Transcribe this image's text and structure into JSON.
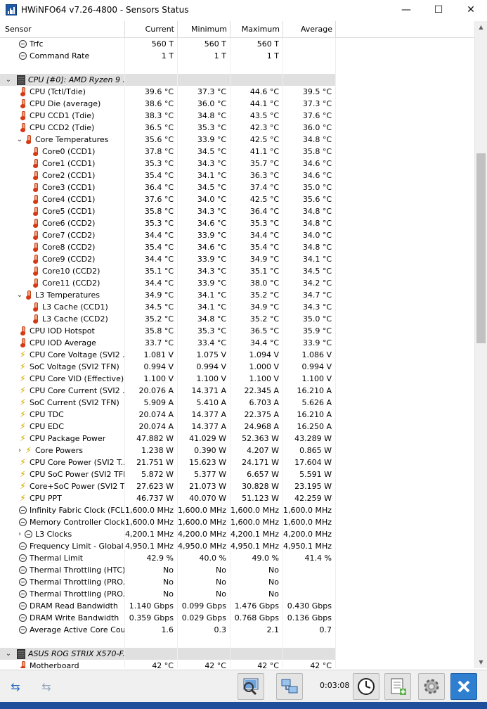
{
  "window": {
    "title": "HWiNFO64 v7.26-4800 - Sensors Status",
    "minimize": "—",
    "maximize": "☐",
    "close": "✕"
  },
  "columns": {
    "sensor": "Sensor",
    "current": "Current",
    "minimum": "Minimum",
    "maximum": "Maximum",
    "average": "Average"
  },
  "rows": [
    {
      "type": "item",
      "depth": 1,
      "icon": "minus",
      "name": "Trfc",
      "cur": "560 T",
      "min": "560 T",
      "max": "560 T",
      "avg": ""
    },
    {
      "type": "item",
      "depth": 1,
      "icon": "minus",
      "name": "Command Rate",
      "cur": "1 T",
      "min": "1 T",
      "max": "1 T",
      "avg": ""
    },
    {
      "type": "blank"
    },
    {
      "type": "group",
      "name": "CPU [#0]: AMD Ryzen 9 ...",
      "expander": "v"
    },
    {
      "type": "item",
      "depth": 1,
      "icon": "therm",
      "name": "CPU (Tctl/Tdie)",
      "cur": "39.6 °C",
      "min": "37.3 °C",
      "max": "44.6 °C",
      "avg": "39.5 °C"
    },
    {
      "type": "item",
      "depth": 1,
      "icon": "therm",
      "name": "CPU Die (average)",
      "cur": "38.6 °C",
      "min": "36.0 °C",
      "max": "44.1 °C",
      "avg": "37.3 °C"
    },
    {
      "type": "item",
      "depth": 1,
      "icon": "therm",
      "name": "CPU CCD1 (Tdie)",
      "cur": "38.3 °C",
      "min": "34.8 °C",
      "max": "43.5 °C",
      "avg": "37.6 °C"
    },
    {
      "type": "item",
      "depth": 1,
      "icon": "therm",
      "name": "CPU CCD2 (Tdie)",
      "cur": "36.5 °C",
      "min": "35.3 °C",
      "max": "42.3 °C",
      "avg": "36.0 °C"
    },
    {
      "type": "item",
      "depth": 1,
      "icon": "therm",
      "expander": "v",
      "name": "Core Temperatures",
      "cur": "35.6 °C",
      "min": "33.9 °C",
      "max": "42.5 °C",
      "avg": "34.8 °C"
    },
    {
      "type": "item",
      "depth": 2,
      "icon": "therm",
      "name": "Core0 (CCD1)",
      "cur": "37.8 °C",
      "min": "34.5 °C",
      "max": "41.1 °C",
      "avg": "35.8 °C"
    },
    {
      "type": "item",
      "depth": 2,
      "icon": "therm",
      "name": "Core1 (CCD1)",
      "cur": "35.3 °C",
      "min": "34.3 °C",
      "max": "35.7 °C",
      "avg": "34.6 °C"
    },
    {
      "type": "item",
      "depth": 2,
      "icon": "therm",
      "name": "Core2 (CCD1)",
      "cur": "35.4 °C",
      "min": "34.1 °C",
      "max": "36.3 °C",
      "avg": "34.6 °C"
    },
    {
      "type": "item",
      "depth": 2,
      "icon": "therm",
      "name": "Core3 (CCD1)",
      "cur": "36.4 °C",
      "min": "34.5 °C",
      "max": "37.4 °C",
      "avg": "35.0 °C"
    },
    {
      "type": "item",
      "depth": 2,
      "icon": "therm",
      "name": "Core4 (CCD1)",
      "cur": "37.6 °C",
      "min": "34.0 °C",
      "max": "42.5 °C",
      "avg": "35.6 °C"
    },
    {
      "type": "item",
      "depth": 2,
      "icon": "therm",
      "name": "Core5 (CCD1)",
      "cur": "35.8 °C",
      "min": "34.3 °C",
      "max": "36.4 °C",
      "avg": "34.8 °C"
    },
    {
      "type": "item",
      "depth": 2,
      "icon": "therm",
      "name": "Core6 (CCD2)",
      "cur": "35.3 °C",
      "min": "34.6 °C",
      "max": "35.3 °C",
      "avg": "34.8 °C"
    },
    {
      "type": "item",
      "depth": 2,
      "icon": "therm",
      "name": "Core7 (CCD2)",
      "cur": "34.4 °C",
      "min": "33.9 °C",
      "max": "34.4 °C",
      "avg": "34.0 °C"
    },
    {
      "type": "item",
      "depth": 2,
      "icon": "therm",
      "name": "Core8 (CCD2)",
      "cur": "35.4 °C",
      "min": "34.6 °C",
      "max": "35.4 °C",
      "avg": "34.8 °C"
    },
    {
      "type": "item",
      "depth": 2,
      "icon": "therm",
      "name": "Core9 (CCD2)",
      "cur": "34.4 °C",
      "min": "33.9 °C",
      "max": "34.9 °C",
      "avg": "34.1 °C"
    },
    {
      "type": "item",
      "depth": 2,
      "icon": "therm",
      "name": "Core10 (CCD2)",
      "cur": "35.1 °C",
      "min": "34.3 °C",
      "max": "35.1 °C",
      "avg": "34.5 °C"
    },
    {
      "type": "item",
      "depth": 2,
      "icon": "therm",
      "name": "Core11 (CCD2)",
      "cur": "34.4 °C",
      "min": "33.9 °C",
      "max": "38.0 °C",
      "avg": "34.2 °C"
    },
    {
      "type": "item",
      "depth": 1,
      "icon": "therm",
      "expander": "v",
      "name": "L3 Temperatures",
      "cur": "34.9 °C",
      "min": "34.1 °C",
      "max": "35.2 °C",
      "avg": "34.7 °C"
    },
    {
      "type": "item",
      "depth": 2,
      "icon": "therm",
      "name": "L3 Cache (CCD1)",
      "cur": "34.5 °C",
      "min": "34.1 °C",
      "max": "34.9 °C",
      "avg": "34.3 °C"
    },
    {
      "type": "item",
      "depth": 2,
      "icon": "therm",
      "name": "L3 Cache (CCD2)",
      "cur": "35.2 °C",
      "min": "34.8 °C",
      "max": "35.2 °C",
      "avg": "35.0 °C"
    },
    {
      "type": "item",
      "depth": 1,
      "icon": "therm",
      "name": "CPU IOD Hotspot",
      "cur": "35.8 °C",
      "min": "35.3 °C",
      "max": "36.5 °C",
      "avg": "35.9 °C"
    },
    {
      "type": "item",
      "depth": 1,
      "icon": "therm",
      "name": "CPU IOD Average",
      "cur": "33.7 °C",
      "min": "33.4 °C",
      "max": "34.4 °C",
      "avg": "33.9 °C"
    },
    {
      "type": "item",
      "depth": 1,
      "icon": "bolt",
      "name": "CPU Core Voltage (SVI2 ...",
      "cur": "1.081 V",
      "min": "1.075 V",
      "max": "1.094 V",
      "avg": "1.086 V"
    },
    {
      "type": "item",
      "depth": 1,
      "icon": "bolt",
      "name": "SoC Voltage (SVI2 TFN)",
      "cur": "0.994 V",
      "min": "0.994 V",
      "max": "1.000 V",
      "avg": "0.994 V"
    },
    {
      "type": "item",
      "depth": 1,
      "icon": "bolt",
      "name": "CPU Core VID (Effective)",
      "cur": "1.100 V",
      "min": "1.100 V",
      "max": "1.100 V",
      "avg": "1.100 V"
    },
    {
      "type": "item",
      "depth": 1,
      "icon": "bolt",
      "name": "CPU Core Current (SVI2 ...",
      "cur": "20.076 A",
      "min": "14.371 A",
      "max": "22.345 A",
      "avg": "16.210 A"
    },
    {
      "type": "item",
      "depth": 1,
      "icon": "bolt",
      "name": "SoC Current (SVI2 TFN)",
      "cur": "5.909 A",
      "min": "5.410 A",
      "max": "6.703 A",
      "avg": "5.626 A"
    },
    {
      "type": "item",
      "depth": 1,
      "icon": "bolt",
      "name": "CPU TDC",
      "cur": "20.074 A",
      "min": "14.377 A",
      "max": "22.375 A",
      "avg": "16.210 A"
    },
    {
      "type": "item",
      "depth": 1,
      "icon": "bolt",
      "name": "CPU EDC",
      "cur": "20.074 A",
      "min": "14.377 A",
      "max": "24.968 A",
      "avg": "16.250 A"
    },
    {
      "type": "item",
      "depth": 1,
      "icon": "bolt",
      "name": "CPU Package Power",
      "cur": "47.882 W",
      "min": "41.029 W",
      "max": "52.363 W",
      "avg": "43.289 W"
    },
    {
      "type": "item",
      "depth": 1,
      "icon": "bolt",
      "expander": ">",
      "name": "Core Powers",
      "cur": "1.238 W",
      "min": "0.390 W",
      "max": "4.207 W",
      "avg": "0.865 W"
    },
    {
      "type": "item",
      "depth": 1,
      "icon": "bolt",
      "name": "CPU Core Power (SVI2 T...",
      "cur": "21.751 W",
      "min": "15.623 W",
      "max": "24.171 W",
      "avg": "17.604 W"
    },
    {
      "type": "item",
      "depth": 1,
      "icon": "bolt",
      "name": "CPU SoC Power (SVI2 TFN)",
      "cur": "5.872 W",
      "min": "5.377 W",
      "max": "6.657 W",
      "avg": "5.591 W"
    },
    {
      "type": "item",
      "depth": 1,
      "icon": "bolt",
      "name": "Core+SoC Power (SVI2 T...",
      "cur": "27.623 W",
      "min": "21.073 W",
      "max": "30.828 W",
      "avg": "23.195 W"
    },
    {
      "type": "item",
      "depth": 1,
      "icon": "bolt",
      "name": "CPU PPT",
      "cur": "46.737 W",
      "min": "40.070 W",
      "max": "51.123 W",
      "avg": "42.259 W"
    },
    {
      "type": "item",
      "depth": 1,
      "icon": "minus",
      "name": "Infinity Fabric Clock (FCLK)",
      "cur": "1,600.0 MHz",
      "min": "1,600.0 MHz",
      "max": "1,600.0 MHz",
      "avg": "1,600.0 MHz"
    },
    {
      "type": "item",
      "depth": 1,
      "icon": "minus",
      "name": "Memory Controller Clock ...",
      "cur": "1,600.0 MHz",
      "min": "1,600.0 MHz",
      "max": "1,600.0 MHz",
      "avg": "1,600.0 MHz"
    },
    {
      "type": "item",
      "depth": 1,
      "icon": "minus",
      "expander": ">",
      "name": "L3 Clocks",
      "cur": "4,200.1 MHz",
      "min": "4,200.0 MHz",
      "max": "4,200.1 MHz",
      "avg": "4,200.0 MHz"
    },
    {
      "type": "item",
      "depth": 1,
      "icon": "minus",
      "name": "Frequency Limit - Global",
      "cur": "4,950.1 MHz",
      "min": "4,950.0 MHz",
      "max": "4,950.1 MHz",
      "avg": "4,950.1 MHz"
    },
    {
      "type": "item",
      "depth": 1,
      "icon": "minus",
      "name": "Thermal Limit",
      "cur": "42.9 %",
      "min": "40.0 %",
      "max": "49.0 %",
      "avg": "41.4 %"
    },
    {
      "type": "item",
      "depth": 1,
      "icon": "minus",
      "name": "Thermal Throttling (HTC)",
      "cur": "No",
      "min": "No",
      "max": "No",
      "avg": ""
    },
    {
      "type": "item",
      "depth": 1,
      "icon": "minus",
      "name": "Thermal Throttling (PRO...",
      "cur": "No",
      "min": "No",
      "max": "No",
      "avg": ""
    },
    {
      "type": "item",
      "depth": 1,
      "icon": "minus",
      "name": "Thermal Throttling (PRO...",
      "cur": "No",
      "min": "No",
      "max": "No",
      "avg": ""
    },
    {
      "type": "item",
      "depth": 1,
      "icon": "minus",
      "name": "DRAM Read Bandwidth",
      "cur": "1.140 Gbps",
      "min": "0.099 Gbps",
      "max": "1.476 Gbps",
      "avg": "0.430 Gbps"
    },
    {
      "type": "item",
      "depth": 1,
      "icon": "minus",
      "name": "DRAM Write Bandwidth",
      "cur": "0.359 Gbps",
      "min": "0.029 Gbps",
      "max": "0.768 Gbps",
      "avg": "0.136 Gbps"
    },
    {
      "type": "item",
      "depth": 1,
      "icon": "minus",
      "name": "Average Active Core Count",
      "cur": "1.6",
      "min": "0.3",
      "max": "2.1",
      "avg": "0.7"
    },
    {
      "type": "blank"
    },
    {
      "type": "group",
      "name": "ASUS ROG STRIX X570-F...",
      "expander": "v"
    },
    {
      "type": "item",
      "depth": 1,
      "icon": "therm",
      "name": "Motherboard",
      "cur": "42 °C",
      "min": "42 °C",
      "max": "42 °C",
      "avg": "42 °C"
    }
  ],
  "toolbar": {
    "timer": "0:03:08",
    "nav_prev_icon": "⇆",
    "nav_next_icon": "⇆"
  },
  "colors": {
    "group_bg": "#e0e0e0",
    "accent": "#1f4e9a",
    "close_button": "#2f7fd1"
  }
}
